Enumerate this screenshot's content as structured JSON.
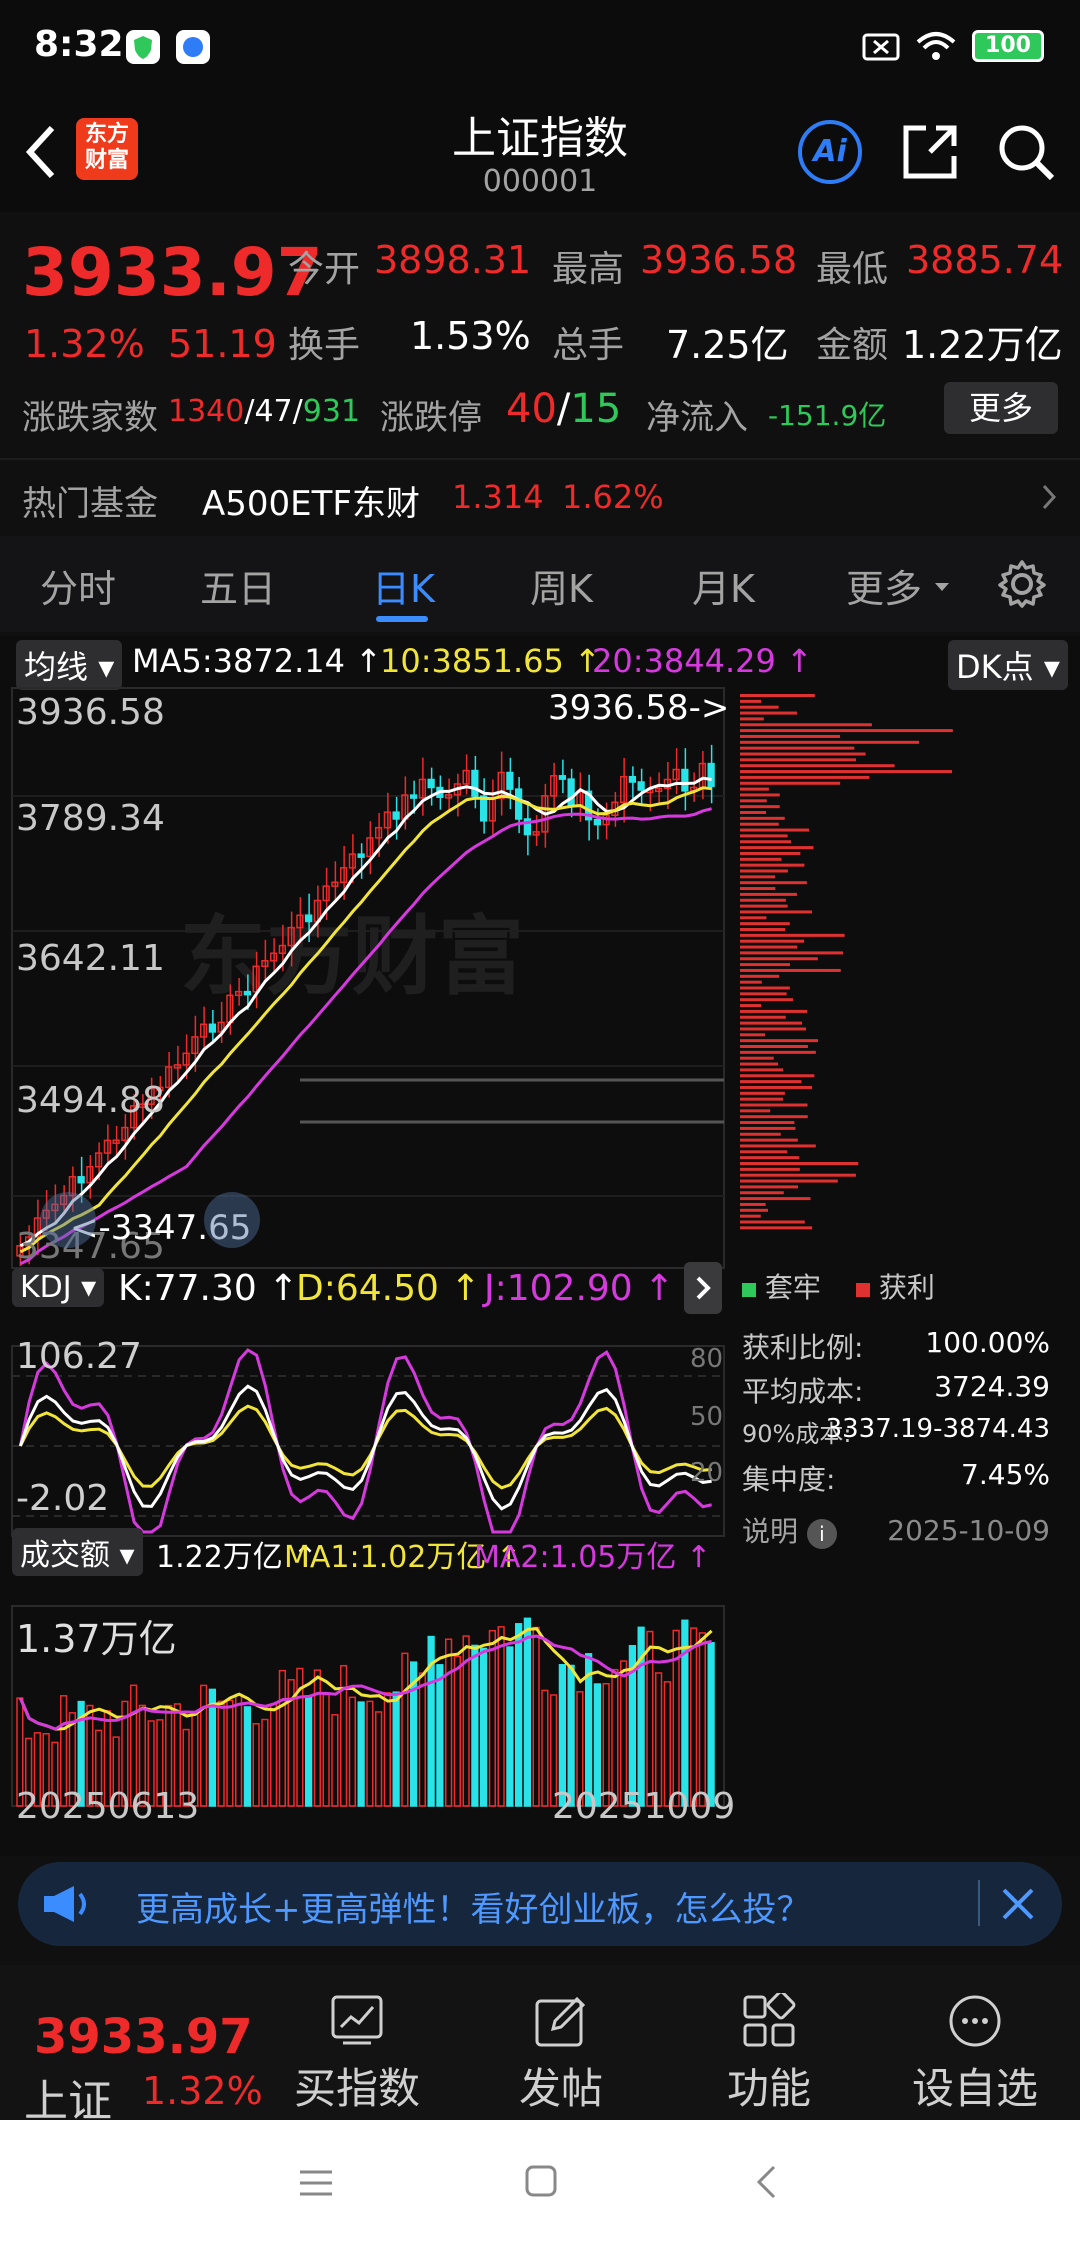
{
  "status": {
    "time": "8:32",
    "battery": "100"
  },
  "header": {
    "title": "上证指数",
    "code": "000001",
    "logo_line1": "东方",
    "logo_line2": "财富",
    "ai": "Ai"
  },
  "quote": {
    "price": "3933.97",
    "pct": "1.32%",
    "chg": "51.19",
    "open_label": "今开",
    "open": "3898.31",
    "high_label": "最高",
    "high": "3936.58",
    "low_label": "最低",
    "low": "3885.74",
    "turnover_label": "换手",
    "turnover": "1.53%",
    "vol_label": "总手",
    "vol": "7.25亿",
    "amount_label": "金额",
    "amount": "1.22万亿",
    "breadth_label": "涨跌家数",
    "up": "1340",
    "flat": "47",
    "down": "931",
    "slash": "/",
    "limit_label": "涨跌停",
    "limit_up": "40",
    "limit_down": "15",
    "inflow_label": "净流入",
    "inflow": "-151.9亿",
    "more": "更多"
  },
  "fund": {
    "label": "热门基金",
    "name": "A500ETF东财",
    "price": "1.314",
    "pct": "1.62%"
  },
  "tabs": [
    "分时",
    "五日",
    "日K",
    "周K",
    "月K",
    "更多"
  ],
  "ma": {
    "selector": "均线",
    "ma5": "MA5:3872.14",
    "ma10": "10:3851.65",
    "ma20": "20:3844.29",
    "arrow": "↑",
    "dk": "DK点"
  },
  "kline": {
    "high_label": "3936.58->",
    "low_label": "<-3347.65",
    "axis": [
      "3936.58",
      "3789.34",
      "3642.11",
      "3494.88",
      "3347.65"
    ],
    "watermark": "东方财富"
  },
  "kdj": {
    "selector": "KDJ",
    "k": "K:77.30",
    "d": "D:64.50",
    "j": "J:102.90",
    "arrow": "↑",
    "top": "106.27",
    "bottom": "-2.02",
    "lv80": "80",
    "lv50": "50",
    "lv20": "20"
  },
  "volume": {
    "selector": "成交额",
    "v": "1.22万亿",
    "ma1": "MA1:1.02万亿",
    "ma2": "MA2:1.05万亿",
    "arrow": "↑",
    "top": "1.37万亿",
    "date_start": "20250613",
    "date_end": "20251009"
  },
  "chip": {
    "legend_trap": "套牢",
    "legend_profit": "获利",
    "rows": [
      {
        "k": "获利比例:",
        "v": "100.00%"
      },
      {
        "k": "平均成本:",
        "v": "3724.39"
      },
      {
        "k": "90%成本:",
        "v": "3337.19-3874.43"
      },
      {
        "k": "集中度:",
        "v": "7.45%"
      }
    ],
    "note": "说明",
    "date": "2025-10-09",
    "profit_color": "#e03131",
    "trap_color": "#2fc85a"
  },
  "banner": {
    "text": "更高成长+更高弹性！看好创业板，怎么投？"
  },
  "bottom": {
    "price": "3933.97",
    "name": "上证",
    "pct": "1.32%",
    "items": [
      "买指数",
      "发帖",
      "功能",
      "设自选"
    ]
  },
  "colors": {
    "up": "#ee2a2a",
    "down": "#2fc85a",
    "accent": "#2f7df6",
    "cyan": "#28e3e8",
    "ma5": "#ffffff",
    "ma10": "#f2e53a",
    "ma20": "#d63adf"
  }
}
